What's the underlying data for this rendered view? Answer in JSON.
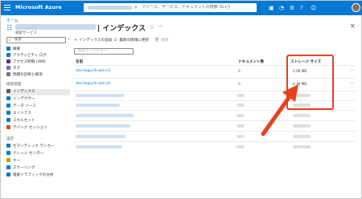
{
  "topbar": {
    "title": "Microsoft Azure",
    "search_placeholder": "リソース、サービス、ドキュメントの検索 (G+/)"
  },
  "breadcrumb": "ホーム",
  "header": {
    "title": "| インデックス",
    "subtitle": "検索サービス"
  },
  "nav": {
    "search_placeholder": "検索",
    "items": [
      {
        "label": "概要",
        "color": "#0078d4"
      },
      {
        "label": "アクティビティ ログ",
        "color": "#0078d4"
      },
      {
        "label": "アクセス制御 (IAM)",
        "color": "#5c2d91"
      },
      {
        "label": "タグ",
        "color": "#8661c5"
      },
      {
        "label": "問題の診断と解決",
        "color": "#7a7574"
      }
    ],
    "section_search": "検索管理",
    "search_items": [
      {
        "label": "インデックス",
        "color": "#605e5c",
        "active": true
      },
      {
        "label": "インデクサー",
        "color": "#0078d4"
      },
      {
        "label": "データ ソース",
        "color": "#0078d4"
      },
      {
        "label": "エイリアス",
        "color": "#0078d4"
      },
      {
        "label": "スキルセット",
        "color": "#0078d4"
      },
      {
        "label": "デバッグ セッション",
        "color": "#e8401c"
      }
    ],
    "section_settings": "設定",
    "settings_items": [
      {
        "label": "セマンティック ランカー",
        "color": "#0078d4"
      },
      {
        "label": "ナレッジ センター",
        "color": "#0078d4"
      },
      {
        "label": "キー",
        "color": "#c19c00"
      },
      {
        "label": "スケーリング",
        "color": "#0078d4"
      },
      {
        "label": "検索トラフィックの分析",
        "color": "#0078d4"
      }
    ]
  },
  "toolbar": {
    "add_index": "インデックスの追加",
    "refresh": "最新の情報に更新",
    "delete": "削除"
  },
  "filter_placeholder": "名前でフィルター...",
  "table": {
    "headers": {
      "name": "名前",
      "doc_count": "ドキュメント数",
      "storage": "ストレージ サイズ"
    },
    "rows": [
      {
        "name": "dev-tagucih-ask-v3",
        "doc_count": "0",
        "storage": "2.56 MB"
      },
      {
        "name": "dev-tagucih-ask-v4",
        "doc_count": "0",
        "storage": "4.39 MB"
      }
    ]
  },
  "colors": {
    "accent": "#0078d4",
    "highlight": "#e8401c"
  }
}
